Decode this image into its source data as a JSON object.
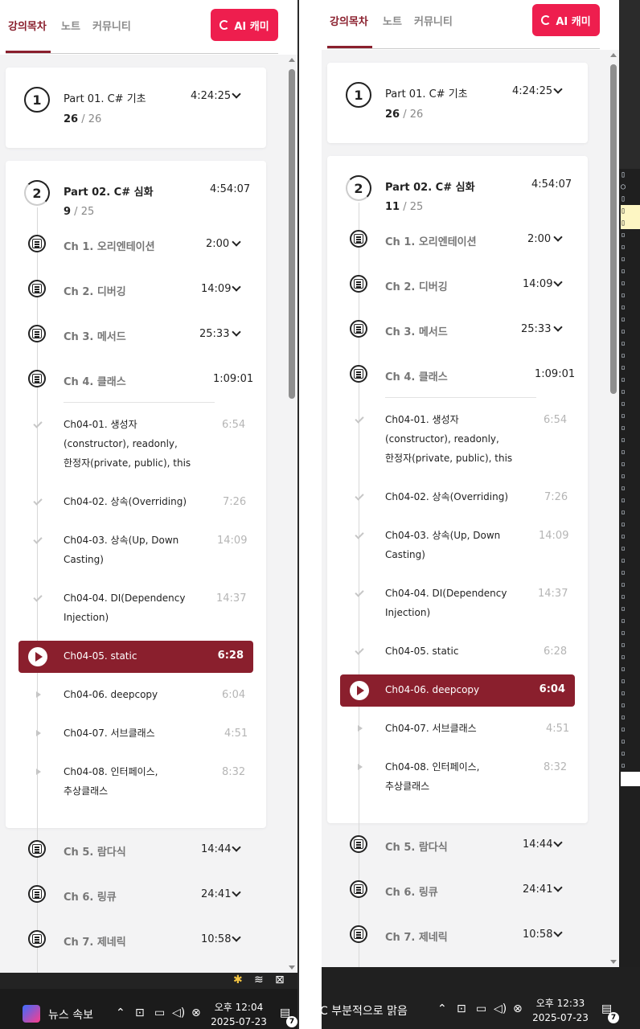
{
  "left": {
    "tabs": [
      "강의목차",
      "노트",
      "커뮤니티"
    ],
    "ai_button": "AI 캐미",
    "part1": {
      "num": "1",
      "title": "Part 01. C# 기초",
      "time": "4:24:25",
      "done": "26",
      "total": "26"
    },
    "part2": {
      "num": "2",
      "title": "Part 02. C# 심화",
      "time": "4:54:07",
      "done": "9",
      "total": "25"
    },
    "chapters_top": [
      {
        "title": "Ch 1. 오리엔테이션",
        "time": "2:00"
      },
      {
        "title": "Ch 2. 디버깅",
        "time": "14:09"
      },
      {
        "title": "Ch 3. 메서드",
        "time": "25:33"
      },
      {
        "title": "Ch 4. 클래스",
        "time": "1:09:01"
      }
    ],
    "lectures": [
      {
        "title1": "Ch04-01. 생성자",
        "title2": "(constructor), readonly,",
        "title3": "한정자(private, public), this",
        "time": "6:54"
      },
      {
        "title1": "Ch04-02. 상속(Overriding)",
        "time": "7:26"
      },
      {
        "title1": "Ch04-03. 상속(Up, Down",
        "title2": "Casting)",
        "time": "14:09"
      },
      {
        "title1": "Ch04-04. DI(Dependency",
        "title2": "Injection)",
        "time": "14:37"
      },
      {
        "title1": "Ch04-05. static",
        "time": "6:28"
      },
      {
        "title1": "Ch04-06. deepcopy",
        "time": "6:04"
      },
      {
        "title1": "Ch04-07. 서브클래스",
        "time": "4:51"
      },
      {
        "title1": "Ch04-08. 인터페이스,",
        "title2": "추상클래스",
        "time": "8:32"
      }
    ],
    "chapters_bottom": [
      {
        "title": "Ch 5. 람다식",
        "time": "14:44"
      },
      {
        "title": "Ch 6. 링큐",
        "time": "24:41"
      },
      {
        "title": "Ch 7. 제네릭",
        "time": "10:58"
      }
    ],
    "taskbar": {
      "news": "뉴스 속보",
      "clock_line1": "오후 12:04",
      "clock_line2": "2025-07-23",
      "badge": "7"
    }
  },
  "right": {
    "tabs": [
      "강의목차",
      "노트",
      "커뮤니티"
    ],
    "ai_button": "AI 캐미",
    "part1": {
      "num": "1",
      "title": "Part 01. C# 기초",
      "time": "4:24:25",
      "done": "26",
      "total": "26"
    },
    "part2": {
      "num": "2",
      "title": "Part 02. C# 심화",
      "time": "4:54:07",
      "done": "11",
      "total": "25"
    },
    "chapters_top": [
      {
        "title": "Ch 1. 오리엔테이션",
        "time": "2:00"
      },
      {
        "title": "Ch 2. 디버깅",
        "time": "14:09"
      },
      {
        "title": "Ch 3. 메서드",
        "time": "25:33"
      },
      {
        "title": "Ch 4. 클래스",
        "time": "1:09:01"
      }
    ],
    "lectures": [
      {
        "title1": "Ch04-01. 생성자",
        "title2": "(constructor), readonly,",
        "title3": "한정자(private, public), this",
        "time": "6:54"
      },
      {
        "title1": "Ch04-02. 상속(Overriding)",
        "time": "7:26"
      },
      {
        "title1": "Ch04-03. 상속(Up, Down",
        "title2": "Casting)",
        "time": "14:09"
      },
      {
        "title1": "Ch04-04. DI(Dependency",
        "title2": "Injection)",
        "time": "14:37"
      },
      {
        "title1": "Ch04-05. static",
        "time": "6:28"
      },
      {
        "title1": "Ch04-06. deepcopy",
        "time": "6:04"
      },
      {
        "title1": "Ch04-07. 서브클래스",
        "time": "4:51"
      },
      {
        "title1": "Ch04-08. 인터페이스,",
        "title2": "추상클래스",
        "time": "8:32"
      }
    ],
    "chapters_bottom": [
      {
        "title": "Ch 5. 람다식",
        "time": "14:44"
      },
      {
        "title": "Ch 6. 링큐",
        "time": "24:41"
      },
      {
        "title": "Ch 7. 제네릭",
        "time": "10:58"
      }
    ],
    "taskbar": {
      "weather": "부분적으로 맑음",
      "clock_line1": "오후 12:33",
      "clock_line2": "2025-07-23",
      "badge": "7"
    }
  },
  "colors": {
    "accent": "#8a1f2d",
    "ai_button": "#ee1e4e",
    "panel_bg": "#f3f3f4"
  },
  "icons": [
    "refresh-icon",
    "chevron-down-icon",
    "document-icon",
    "check-icon",
    "play-icon",
    "triangle-icon",
    "notification-icon"
  ]
}
